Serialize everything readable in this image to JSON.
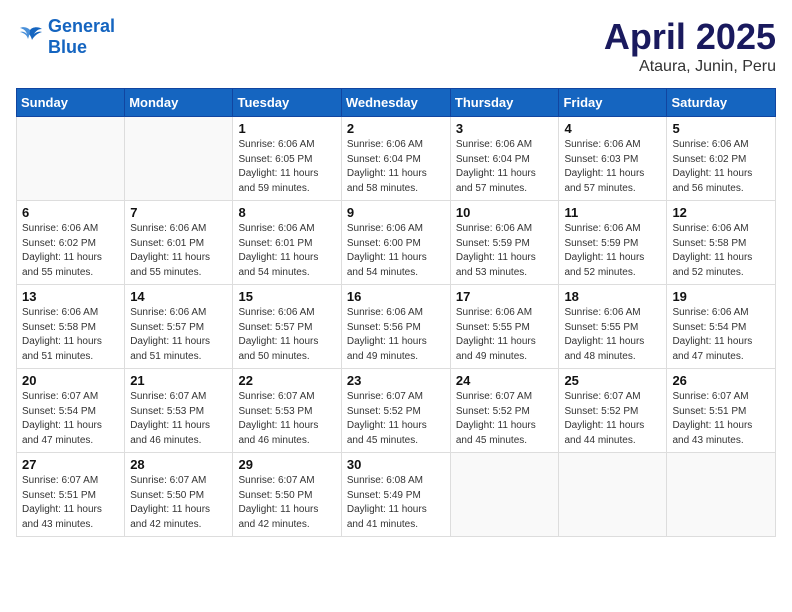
{
  "header": {
    "logo_general": "General",
    "logo_blue": "Blue",
    "month": "April 2025",
    "location": "Ataura, Junin, Peru"
  },
  "weekdays": [
    "Sunday",
    "Monday",
    "Tuesday",
    "Wednesday",
    "Thursday",
    "Friday",
    "Saturday"
  ],
  "weeks": [
    [
      {
        "day": "",
        "info": ""
      },
      {
        "day": "",
        "info": ""
      },
      {
        "day": "1",
        "info": "Sunrise: 6:06 AM\nSunset: 6:05 PM\nDaylight: 11 hours and 59 minutes."
      },
      {
        "day": "2",
        "info": "Sunrise: 6:06 AM\nSunset: 6:04 PM\nDaylight: 11 hours and 58 minutes."
      },
      {
        "day": "3",
        "info": "Sunrise: 6:06 AM\nSunset: 6:04 PM\nDaylight: 11 hours and 57 minutes."
      },
      {
        "day": "4",
        "info": "Sunrise: 6:06 AM\nSunset: 6:03 PM\nDaylight: 11 hours and 57 minutes."
      },
      {
        "day": "5",
        "info": "Sunrise: 6:06 AM\nSunset: 6:02 PM\nDaylight: 11 hours and 56 minutes."
      }
    ],
    [
      {
        "day": "6",
        "info": "Sunrise: 6:06 AM\nSunset: 6:02 PM\nDaylight: 11 hours and 55 minutes."
      },
      {
        "day": "7",
        "info": "Sunrise: 6:06 AM\nSunset: 6:01 PM\nDaylight: 11 hours and 55 minutes."
      },
      {
        "day": "8",
        "info": "Sunrise: 6:06 AM\nSunset: 6:01 PM\nDaylight: 11 hours and 54 minutes."
      },
      {
        "day": "9",
        "info": "Sunrise: 6:06 AM\nSunset: 6:00 PM\nDaylight: 11 hours and 54 minutes."
      },
      {
        "day": "10",
        "info": "Sunrise: 6:06 AM\nSunset: 5:59 PM\nDaylight: 11 hours and 53 minutes."
      },
      {
        "day": "11",
        "info": "Sunrise: 6:06 AM\nSunset: 5:59 PM\nDaylight: 11 hours and 52 minutes."
      },
      {
        "day": "12",
        "info": "Sunrise: 6:06 AM\nSunset: 5:58 PM\nDaylight: 11 hours and 52 minutes."
      }
    ],
    [
      {
        "day": "13",
        "info": "Sunrise: 6:06 AM\nSunset: 5:58 PM\nDaylight: 11 hours and 51 minutes."
      },
      {
        "day": "14",
        "info": "Sunrise: 6:06 AM\nSunset: 5:57 PM\nDaylight: 11 hours and 51 minutes."
      },
      {
        "day": "15",
        "info": "Sunrise: 6:06 AM\nSunset: 5:57 PM\nDaylight: 11 hours and 50 minutes."
      },
      {
        "day": "16",
        "info": "Sunrise: 6:06 AM\nSunset: 5:56 PM\nDaylight: 11 hours and 49 minutes."
      },
      {
        "day": "17",
        "info": "Sunrise: 6:06 AM\nSunset: 5:55 PM\nDaylight: 11 hours and 49 minutes."
      },
      {
        "day": "18",
        "info": "Sunrise: 6:06 AM\nSunset: 5:55 PM\nDaylight: 11 hours and 48 minutes."
      },
      {
        "day": "19",
        "info": "Sunrise: 6:06 AM\nSunset: 5:54 PM\nDaylight: 11 hours and 47 minutes."
      }
    ],
    [
      {
        "day": "20",
        "info": "Sunrise: 6:07 AM\nSunset: 5:54 PM\nDaylight: 11 hours and 47 minutes."
      },
      {
        "day": "21",
        "info": "Sunrise: 6:07 AM\nSunset: 5:53 PM\nDaylight: 11 hours and 46 minutes."
      },
      {
        "day": "22",
        "info": "Sunrise: 6:07 AM\nSunset: 5:53 PM\nDaylight: 11 hours and 46 minutes."
      },
      {
        "day": "23",
        "info": "Sunrise: 6:07 AM\nSunset: 5:52 PM\nDaylight: 11 hours and 45 minutes."
      },
      {
        "day": "24",
        "info": "Sunrise: 6:07 AM\nSunset: 5:52 PM\nDaylight: 11 hours and 45 minutes."
      },
      {
        "day": "25",
        "info": "Sunrise: 6:07 AM\nSunset: 5:52 PM\nDaylight: 11 hours and 44 minutes."
      },
      {
        "day": "26",
        "info": "Sunrise: 6:07 AM\nSunset: 5:51 PM\nDaylight: 11 hours and 43 minutes."
      }
    ],
    [
      {
        "day": "27",
        "info": "Sunrise: 6:07 AM\nSunset: 5:51 PM\nDaylight: 11 hours and 43 minutes."
      },
      {
        "day": "28",
        "info": "Sunrise: 6:07 AM\nSunset: 5:50 PM\nDaylight: 11 hours and 42 minutes."
      },
      {
        "day": "29",
        "info": "Sunrise: 6:07 AM\nSunset: 5:50 PM\nDaylight: 11 hours and 42 minutes."
      },
      {
        "day": "30",
        "info": "Sunrise: 6:08 AM\nSunset: 5:49 PM\nDaylight: 11 hours and 41 minutes."
      },
      {
        "day": "",
        "info": ""
      },
      {
        "day": "",
        "info": ""
      },
      {
        "day": "",
        "info": ""
      }
    ]
  ]
}
